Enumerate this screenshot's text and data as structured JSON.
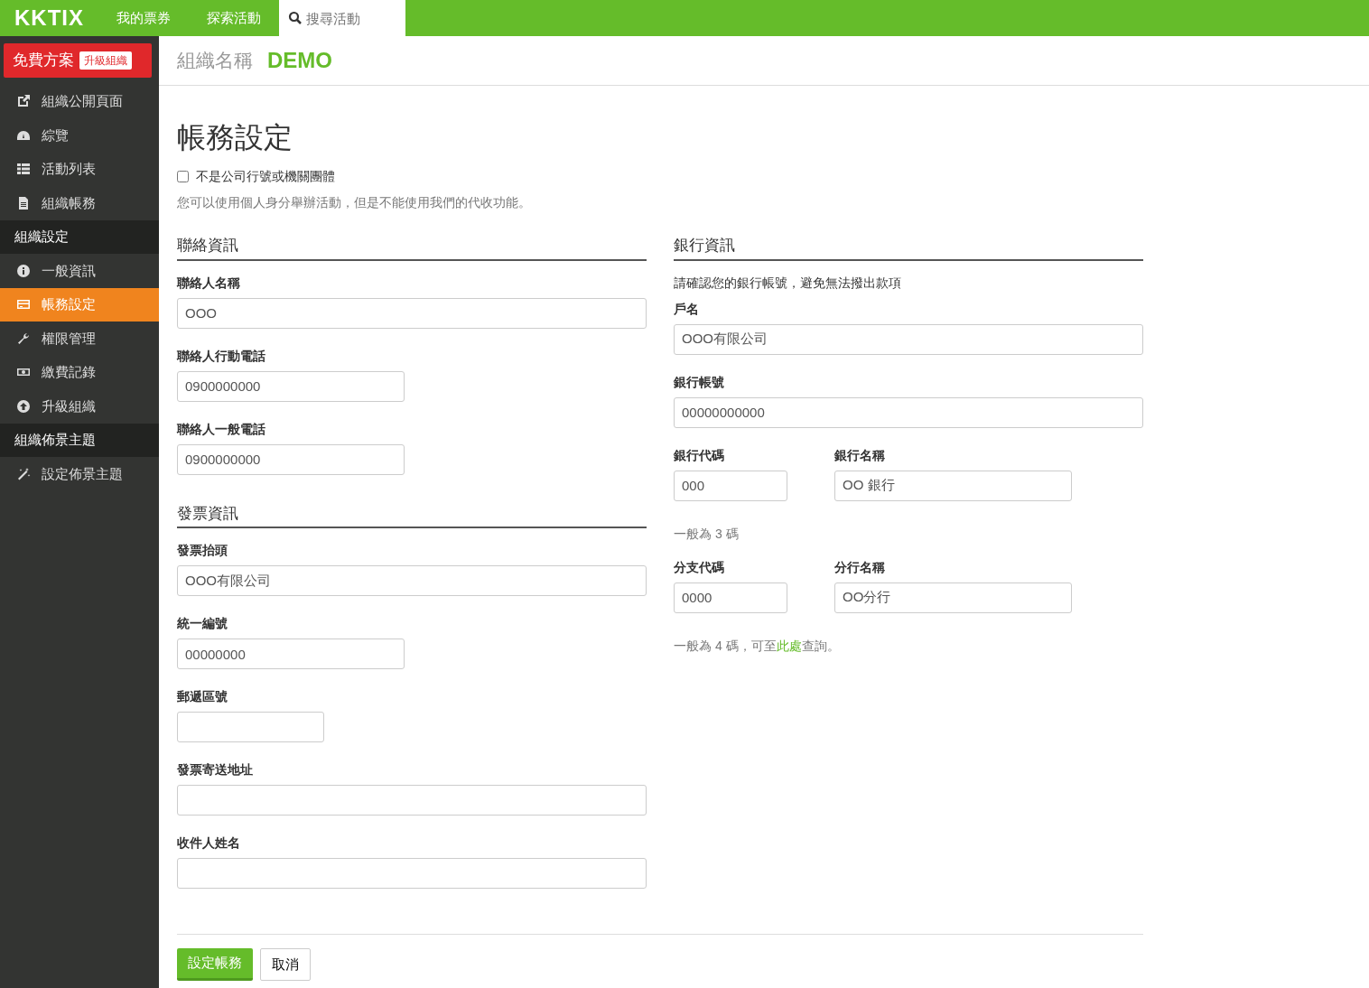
{
  "topbar": {
    "logo": "KKTIX",
    "links": [
      "我的票券",
      "探索活動"
    ],
    "search": {
      "placeholder": "搜尋活動"
    }
  },
  "plan": {
    "label": "免費方案",
    "upgrade": "升級組織"
  },
  "org": {
    "label": "組織名稱",
    "name": "DEMO"
  },
  "sidebar": [
    {
      "kind": "link",
      "label": "組織公開頁面",
      "selected": false
    },
    {
      "kind": "link",
      "label": "綜覽",
      "selected": false
    },
    {
      "kind": "link",
      "label": "活動列表",
      "selected": false
    },
    {
      "kind": "link",
      "label": "組織帳務",
      "selected": false
    },
    {
      "kind": "header",
      "label": "組織設定"
    },
    {
      "kind": "link",
      "label": "一般資訊",
      "selected": false
    },
    {
      "kind": "link",
      "label": "帳務設定",
      "selected": true
    },
    {
      "kind": "link",
      "label": "權限管理",
      "selected": false
    },
    {
      "kind": "link",
      "label": "繳費記錄",
      "selected": false
    },
    {
      "kind": "link",
      "label": "升級組織",
      "selected": false
    },
    {
      "kind": "header",
      "label": "組織佈景主題"
    },
    {
      "kind": "link",
      "label": "設定佈景主題",
      "selected": false
    }
  ],
  "page_title": "帳務設定",
  "individual": {
    "label": "不是公司行號或機關團體",
    "checked": false
  },
  "individual_note": "您可以使用個人身分舉辦活動，但是不能使用我們的代收功能。",
  "contact": {
    "title": "聯絡資訊",
    "items": [
      {
        "kind": "wide",
        "label": "聯絡人名稱",
        "value": "OOO"
      },
      {
        "kind": "medium",
        "label": "聯絡人行動電話",
        "value": "0900000000"
      },
      {
        "kind": "medium",
        "label": "聯絡人一般電話",
        "value": "0900000000"
      }
    ]
  },
  "invoice": {
    "title": "發票資訊",
    "items": [
      {
        "kind": "wide",
        "label": "發票抬頭",
        "value": "OOO有限公司"
      },
      {
        "kind": "medium",
        "label": "統一編號",
        "value": "00000000"
      },
      {
        "kind": "small",
        "label": "郵遞區號"
      },
      {
        "kind": "wide",
        "label": "發票寄送地址"
      },
      {
        "kind": "wide",
        "label": "收件人姓名"
      }
    ]
  },
  "bank": {
    "title": "銀行資訊",
    "note": "請確認您的銀行帳號，避免無法撥出款項",
    "items": [
      {
        "kind": "wide",
        "label": "戶名",
        "value": "OOO有限公司"
      },
      {
        "kind": "wide",
        "label": "銀行帳號",
        "value": "00000000000"
      },
      {
        "kind": "pair",
        "fields": [
          {
            "label": "銀行代碼",
            "value": "000"
          },
          {
            "label": "銀行名稱",
            "value": "OO 銀行"
          }
        ]
      },
      {
        "kind": "hint",
        "text": "一般為 3 碼"
      },
      {
        "kind": "pair",
        "fields": [
          {
            "label": "分支代碼",
            "value": "0000"
          },
          {
            "label": "分行名稱",
            "value": "OO分行"
          }
        ]
      },
      {
        "kind": "hint",
        "text": "一般為 4 碼，可至",
        "link": "此處",
        "after": "查詢。"
      }
    ]
  },
  "buttons": {
    "submit": "設定帳務",
    "cancel": "取消"
  }
}
